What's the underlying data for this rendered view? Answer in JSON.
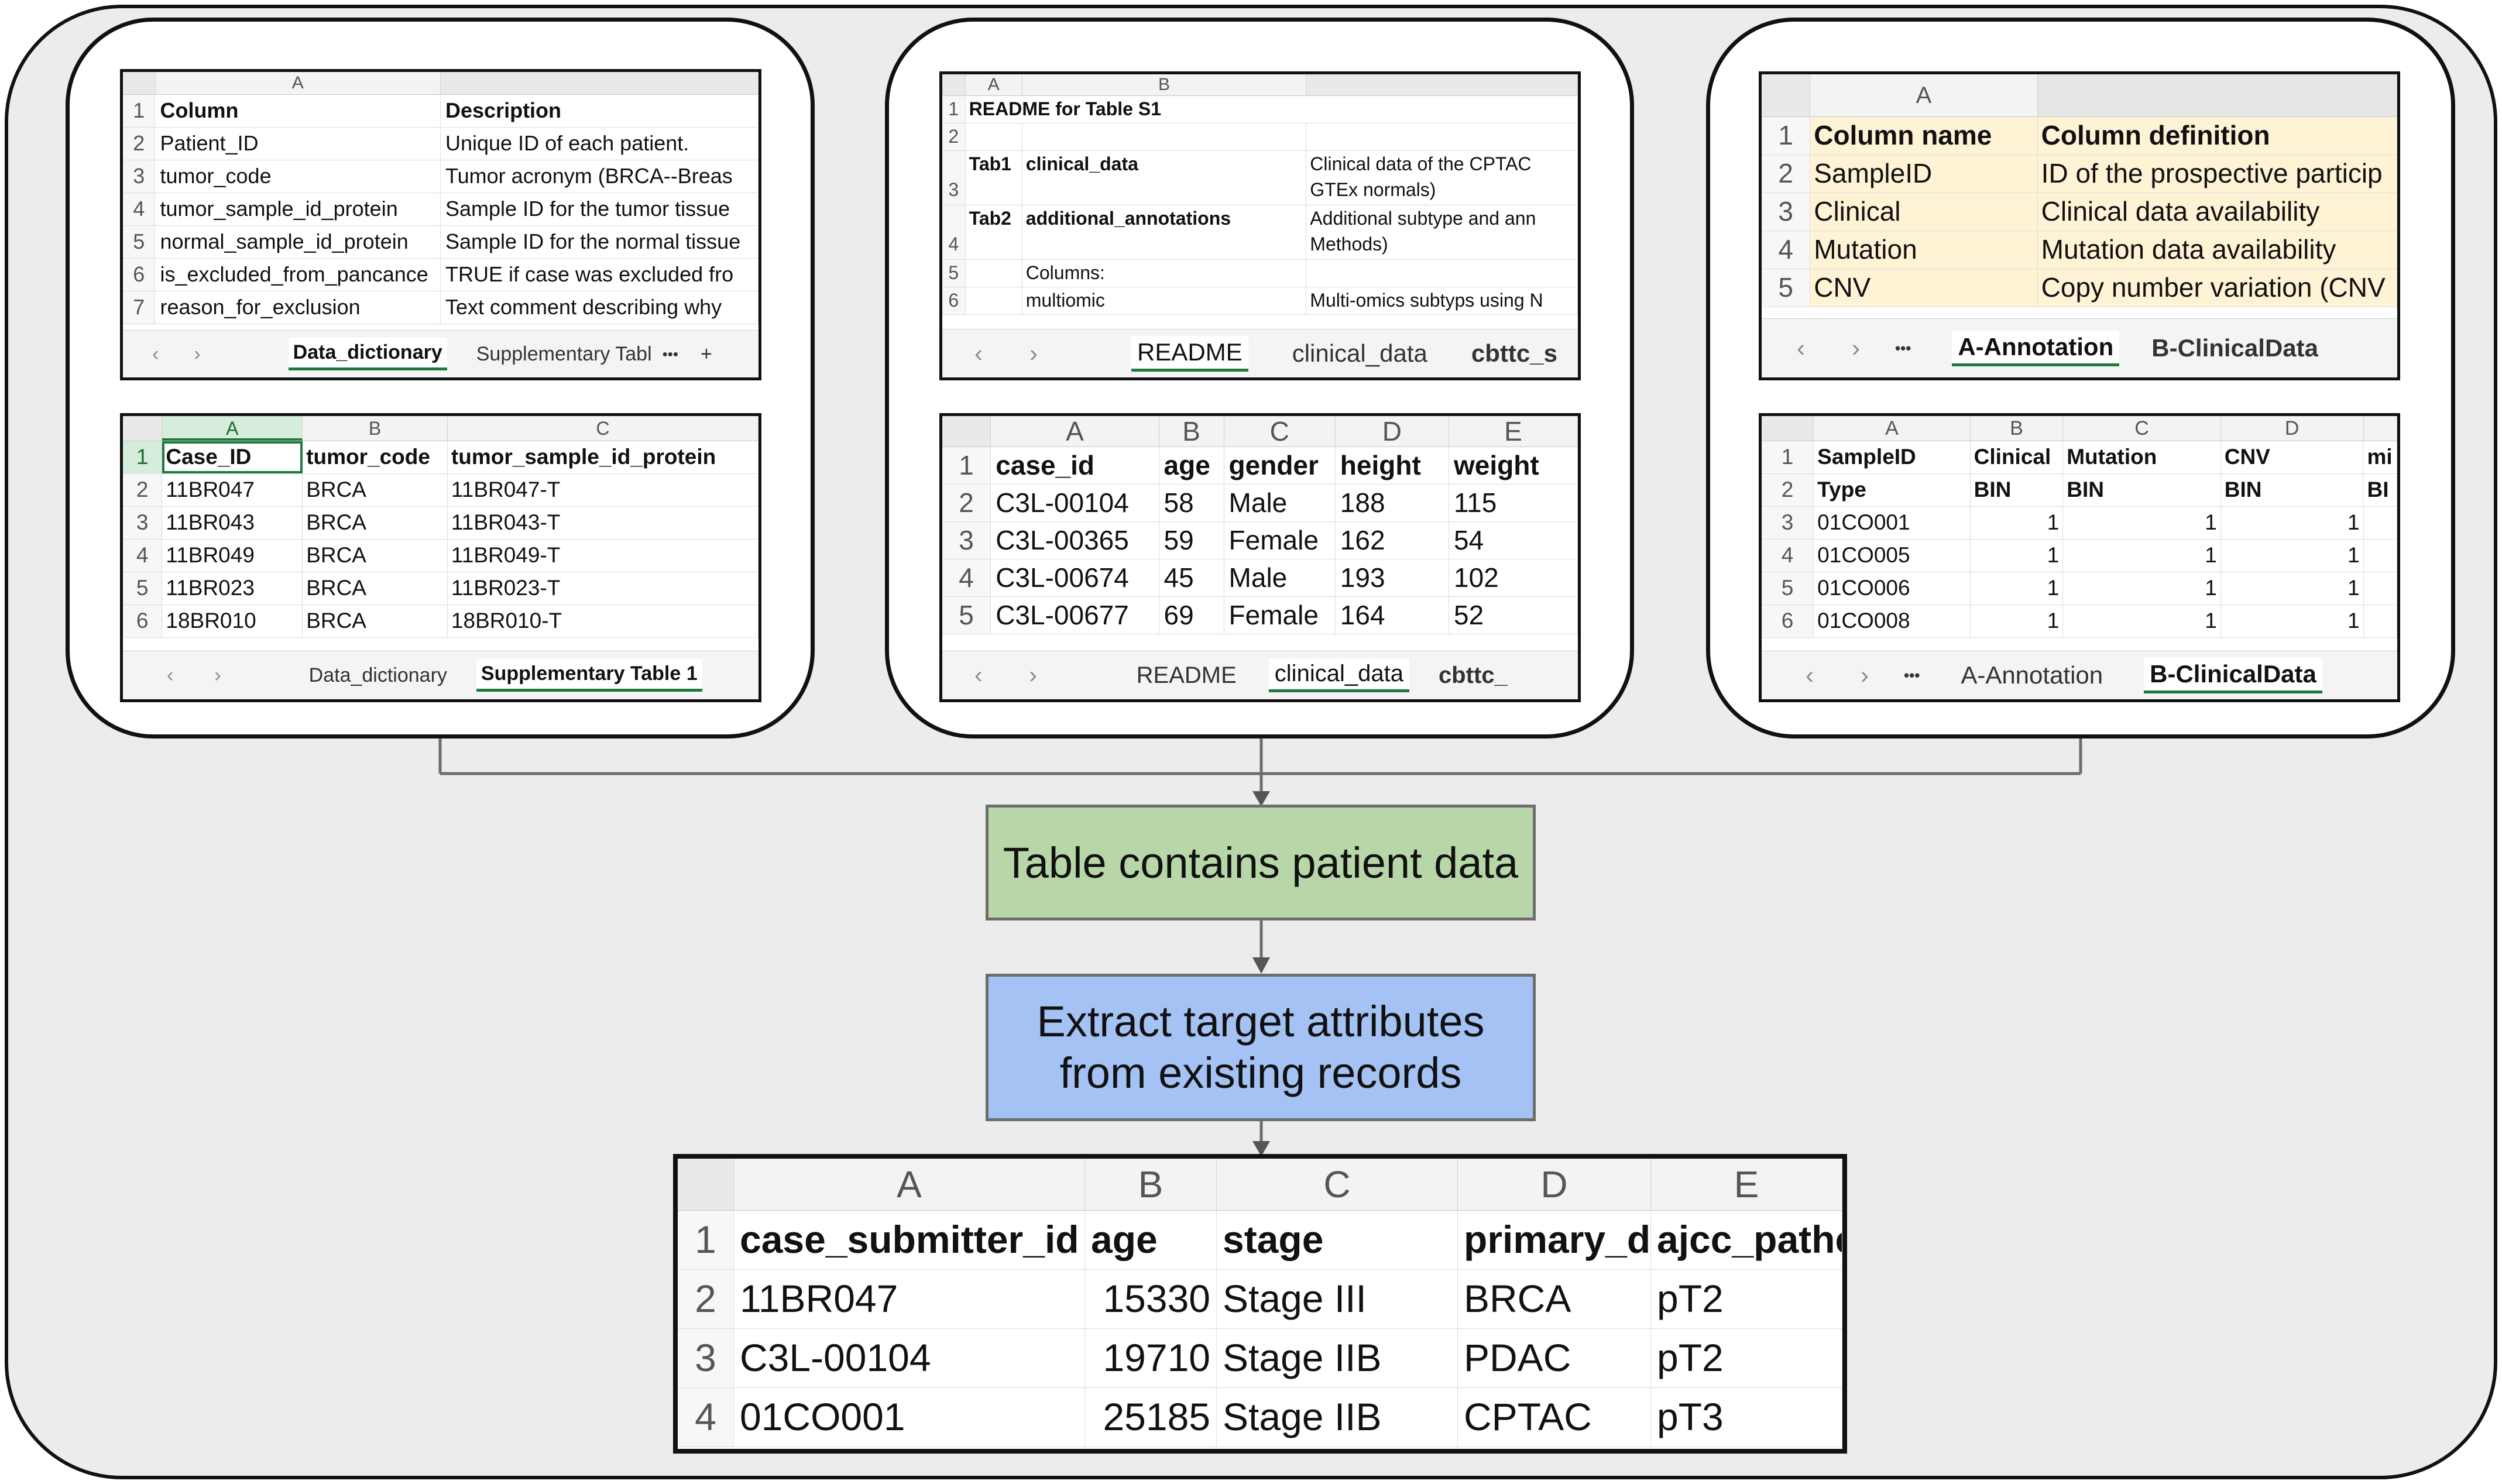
{
  "panel1": {
    "top": {
      "col_letters": [
        "A",
        ""
      ],
      "rows": [
        {
          "n": "1",
          "cells": [
            "Column",
            "Description"
          ]
        },
        {
          "n": "2",
          "cells": [
            "Patient_ID",
            "Unique ID of each patient."
          ]
        },
        {
          "n": "3",
          "cells": [
            "tumor_code",
            "Tumor acronym (BRCA--Breas"
          ]
        },
        {
          "n": "4",
          "cells": [
            "tumor_sample_id_protein",
            "Sample ID for the tumor tissue"
          ]
        },
        {
          "n": "5",
          "cells": [
            "normal_sample_id_protein",
            "Sample ID for the normal tissue"
          ]
        },
        {
          "n": "6",
          "cells": [
            "is_excluded_from_pancance",
            "TRUE if case was excluded fro"
          ]
        },
        {
          "n": "7",
          "cells": [
            "reason_for_exclusion",
            "Text comment describing why"
          ]
        }
      ],
      "tabs": [
        "Data_dictionary",
        "Supplementary Tabl"
      ],
      "more": "•••",
      "plus": "+"
    },
    "bottom": {
      "col_letters": [
        "A",
        "B",
        "C"
      ],
      "rows": [
        {
          "n": "1",
          "cells": [
            "Case_ID",
            "tumor_code",
            "tumor_sample_id_protein"
          ]
        },
        {
          "n": "2",
          "cells": [
            "11BR047",
            "BRCA",
            "11BR047-T"
          ]
        },
        {
          "n": "3",
          "cells": [
            "11BR043",
            "BRCA",
            "11BR043-T"
          ]
        },
        {
          "n": "4",
          "cells": [
            "11BR049",
            "BRCA",
            "11BR049-T"
          ]
        },
        {
          "n": "5",
          "cells": [
            "11BR023",
            "BRCA",
            "11BR023-T"
          ]
        },
        {
          "n": "6",
          "cells": [
            "18BR010",
            "BRCA",
            "18BR010-T"
          ]
        }
      ],
      "tabs": [
        "Data_dictionary",
        "Supplementary Table 1"
      ]
    }
  },
  "panel2": {
    "top": {
      "col_letters": [
        "A",
        "B",
        ""
      ],
      "rows": [
        {
          "n": "1",
          "cells": [
            "README for Table S1",
            "",
            ""
          ]
        },
        {
          "n": "2",
          "cells": [
            "",
            "",
            ""
          ]
        },
        {
          "n": "3",
          "cells": [
            "Tab1",
            "clinical_data",
            "Clinical data of the CPTAC",
            "GTEx normals)"
          ]
        },
        {
          "n": "4",
          "cells": [
            "Tab2",
            "additional_annotations",
            "Additional subtype and ann",
            "Methods)"
          ]
        },
        {
          "n": "5",
          "cells": [
            "",
            "Columns:",
            ""
          ]
        },
        {
          "n": "6",
          "cells": [
            "",
            "multiomic",
            "Multi-omics subtyps using N"
          ]
        }
      ],
      "tabs": [
        "README",
        "clinical_data",
        "cbttc_s"
      ]
    },
    "bottom": {
      "col_letters": [
        "A",
        "B",
        "C",
        "D",
        "E"
      ],
      "rows": [
        {
          "n": "1",
          "cells": [
            "case_id",
            "age",
            "gender",
            "height",
            "weight"
          ]
        },
        {
          "n": "2",
          "cells": [
            "C3L-00104",
            "58",
            "Male",
            "188",
            "115"
          ]
        },
        {
          "n": "3",
          "cells": [
            "C3L-00365",
            "59",
            "Female",
            "162",
            "54"
          ]
        },
        {
          "n": "4",
          "cells": [
            "C3L-00674",
            "45",
            "Male",
            "193",
            "102"
          ]
        },
        {
          "n": "5",
          "cells": [
            "C3L-00677",
            "69",
            "Female",
            "164",
            "52"
          ]
        }
      ],
      "tabs": [
        "README",
        "clinical_data",
        "cbttc_"
      ]
    }
  },
  "panel3": {
    "top": {
      "col_letters": [
        "A",
        ""
      ],
      "rows": [
        {
          "n": "1",
          "cells": [
            "Column name",
            "Column definition"
          ]
        },
        {
          "n": "2",
          "cells": [
            "SampleID",
            "ID of the prospective particip"
          ]
        },
        {
          "n": "3",
          "cells": [
            "Clinical",
            "Clinical data availability"
          ]
        },
        {
          "n": "4",
          "cells": [
            "Mutation",
            "Mutation data availability"
          ]
        },
        {
          "n": "5",
          "cells": [
            "CNV",
            "Copy number variation (CNV"
          ]
        }
      ],
      "tabs": [
        "A-Annotation",
        "B-ClinicalData"
      ],
      "more": "•••"
    },
    "bottom": {
      "col_letters": [
        "A",
        "B",
        "C",
        "D",
        ""
      ],
      "rows": [
        {
          "n": "1",
          "cells": [
            "SampleID",
            "Clinical",
            "Mutation",
            "CNV",
            "mi"
          ]
        },
        {
          "n": "2",
          "cells": [
            "Type",
            "BIN",
            "BIN",
            "BIN",
            "BI"
          ]
        },
        {
          "n": "3",
          "cells": [
            "01CO001",
            "1",
            "1",
            "1",
            ""
          ]
        },
        {
          "n": "4",
          "cells": [
            "01CO005",
            "1",
            "1",
            "1",
            ""
          ]
        },
        {
          "n": "5",
          "cells": [
            "01CO006",
            "1",
            "1",
            "1",
            ""
          ]
        },
        {
          "n": "6",
          "cells": [
            "01CO008",
            "1",
            "1",
            "1",
            ""
          ]
        }
      ],
      "tabs": [
        "A-Annotation",
        "B-ClinicalData"
      ],
      "more": "•••"
    }
  },
  "flow": {
    "box1": "Table contains patient data",
    "box2_line1": "Extract target attributes",
    "box2_line2": "from existing records",
    "box1_color": "#b7d7a8",
    "box2_color": "#a4c2f4"
  },
  "result": {
    "col_letters": [
      "A",
      "B",
      "C",
      "D",
      "E"
    ],
    "rows": [
      {
        "n": "1",
        "cells": [
          "case_submitter_id",
          "age",
          "stage",
          "primary_d",
          "ajcc_pathc"
        ]
      },
      {
        "n": "2",
        "cells": [
          "11BR047",
          "15330",
          "Stage III",
          "BRCA",
          "pT2"
        ]
      },
      {
        "n": "3",
        "cells": [
          "C3L-00104",
          "19710",
          "Stage IIB",
          "PDAC",
          "pT2"
        ]
      },
      {
        "n": "4",
        "cells": [
          "01CO001",
          "25185",
          "Stage IIB",
          "CPTAC",
          "pT3"
        ]
      }
    ]
  },
  "icons": {
    "nav_prev": "chevron-left-icon",
    "nav_next": "chevron-right-icon"
  },
  "nav_prev_glyph": "‹",
  "nav_next_glyph": "›"
}
